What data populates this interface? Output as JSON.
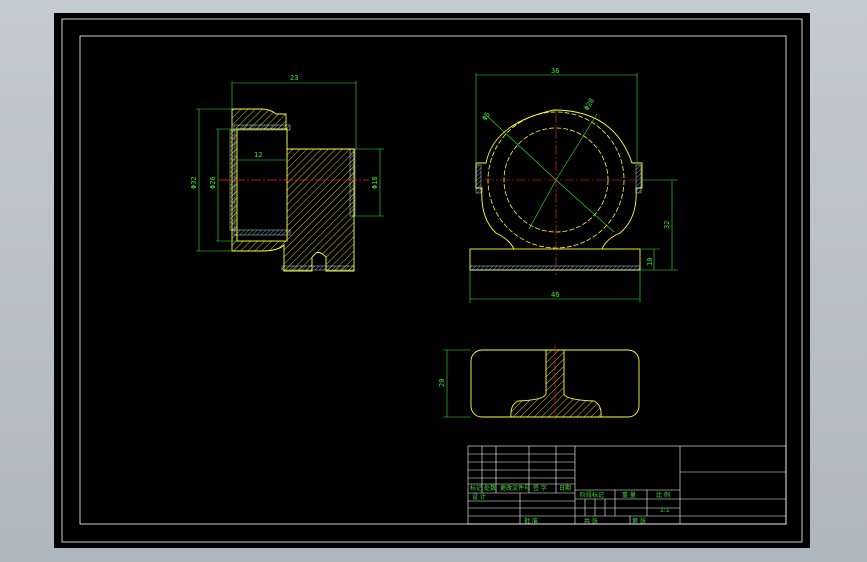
{
  "colors": {
    "background": "#000000",
    "frame": "#ffffff",
    "outline": "#ffff33",
    "dimension": "#35e82f",
    "centerline": "#ff2020",
    "hatch": "#ffff33"
  },
  "dimensions": {
    "front_width": "23",
    "front_bore_depth": "12",
    "front_outer_dia": "Φ32",
    "front_bore_dia": "Φ26",
    "front_right_dia": "Φ18",
    "side_top_width": "36",
    "side_dia_a": "Φ5",
    "side_dia_b": "Φ28",
    "side_height": "32",
    "side_base_thick": "10",
    "side_base_width": "46",
    "bottom_height": "20"
  },
  "title_block": {
    "row_labels": [
      "标记",
      "处数",
      "更改文件号",
      "签 字",
      "日期"
    ],
    "designer": "设 计",
    "stage_mark": "阶段标记",
    "weight": "重 量",
    "scale": "比 例",
    "scale_value": "1:1",
    "approve": "批 准",
    "sheet_total": "共   张",
    "sheet_no": "第   张"
  }
}
